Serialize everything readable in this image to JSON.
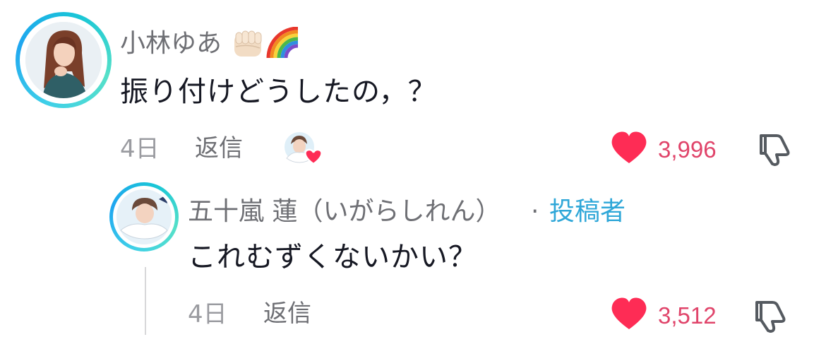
{
  "comments": {
    "main": {
      "username": "小林ゆあ",
      "emoji_fist": "👊🏻",
      "emoji_rainbow": "🌈",
      "text": "振り付けどうしたの，？",
      "time": "4日",
      "reply_label": "返信",
      "like_count": "3,996",
      "liked_by_creator": true
    },
    "reply": {
      "username": "五十嵐 蓮（いがらしれん）",
      "separator": "·",
      "author_badge": "投稿者",
      "text": "これむずくないかい？",
      "time": "4日",
      "reply_label": "返信",
      "like_count": "3,512"
    }
  },
  "icons": {
    "like": "heart-icon",
    "dislike": "thumbs-down-icon",
    "creator_liked": "creator-liked-heart-icon"
  },
  "colors": {
    "heart": "#fe2c55",
    "count": "#e0446a",
    "author_badge": "#2fa7d8",
    "username": "#6e6f74",
    "avatar_ring": "#3fd0e8"
  }
}
